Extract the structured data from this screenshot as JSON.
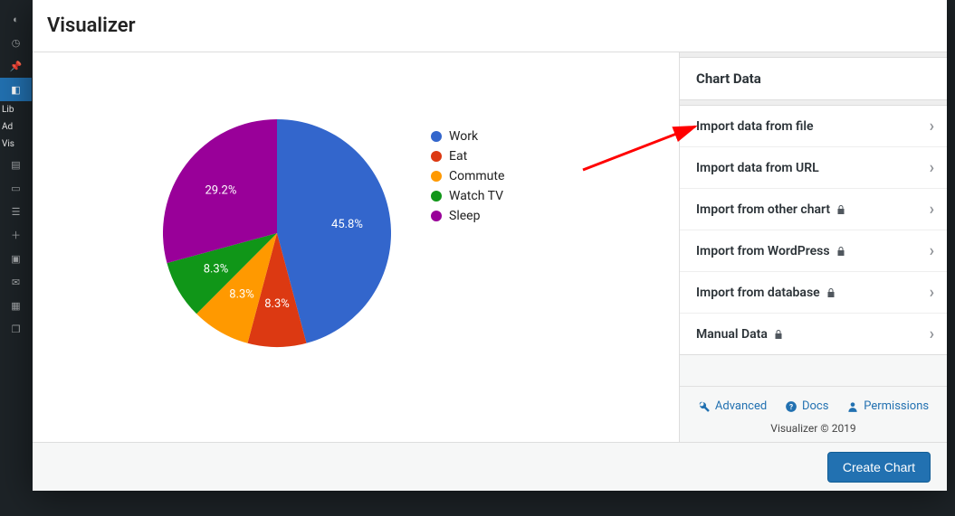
{
  "wp_sidebar": {
    "text_items": [
      "Lib",
      "Ad",
      "Vis"
    ]
  },
  "modal": {
    "title": "Visualizer",
    "create_button": "Create Chart"
  },
  "panel": {
    "title": "Chart Data",
    "rows": [
      {
        "label": "Import data from file",
        "locked": false
      },
      {
        "label": "Import data from URL",
        "locked": false
      },
      {
        "label": "Import from other chart",
        "locked": true
      },
      {
        "label": "Import from WordPress",
        "locked": true
      },
      {
        "label": "Import from database",
        "locked": true
      },
      {
        "label": "Manual Data",
        "locked": true
      }
    ],
    "footer": {
      "advanced": "Advanced",
      "docs": "Docs",
      "permissions": "Permissions",
      "copyright": "Visualizer © 2019"
    }
  },
  "chart_data": {
    "type": "pie",
    "title": "",
    "series": [
      {
        "name": "Work",
        "value": 45.8,
        "color": "#3366cc",
        "label": "45.8%"
      },
      {
        "name": "Eat",
        "value": 8.3,
        "color": "#dc3912",
        "label": "8.3%"
      },
      {
        "name": "Commute",
        "value": 8.3,
        "color": "#ff9900",
        "label": "8.3%"
      },
      {
        "name": "Watch TV",
        "value": 8.3,
        "color": "#109618",
        "label": "8.3%"
      },
      {
        "name": "Sleep",
        "value": 29.2,
        "color": "#990099",
        "label": "29.2%"
      }
    ],
    "legend_position": "right"
  }
}
